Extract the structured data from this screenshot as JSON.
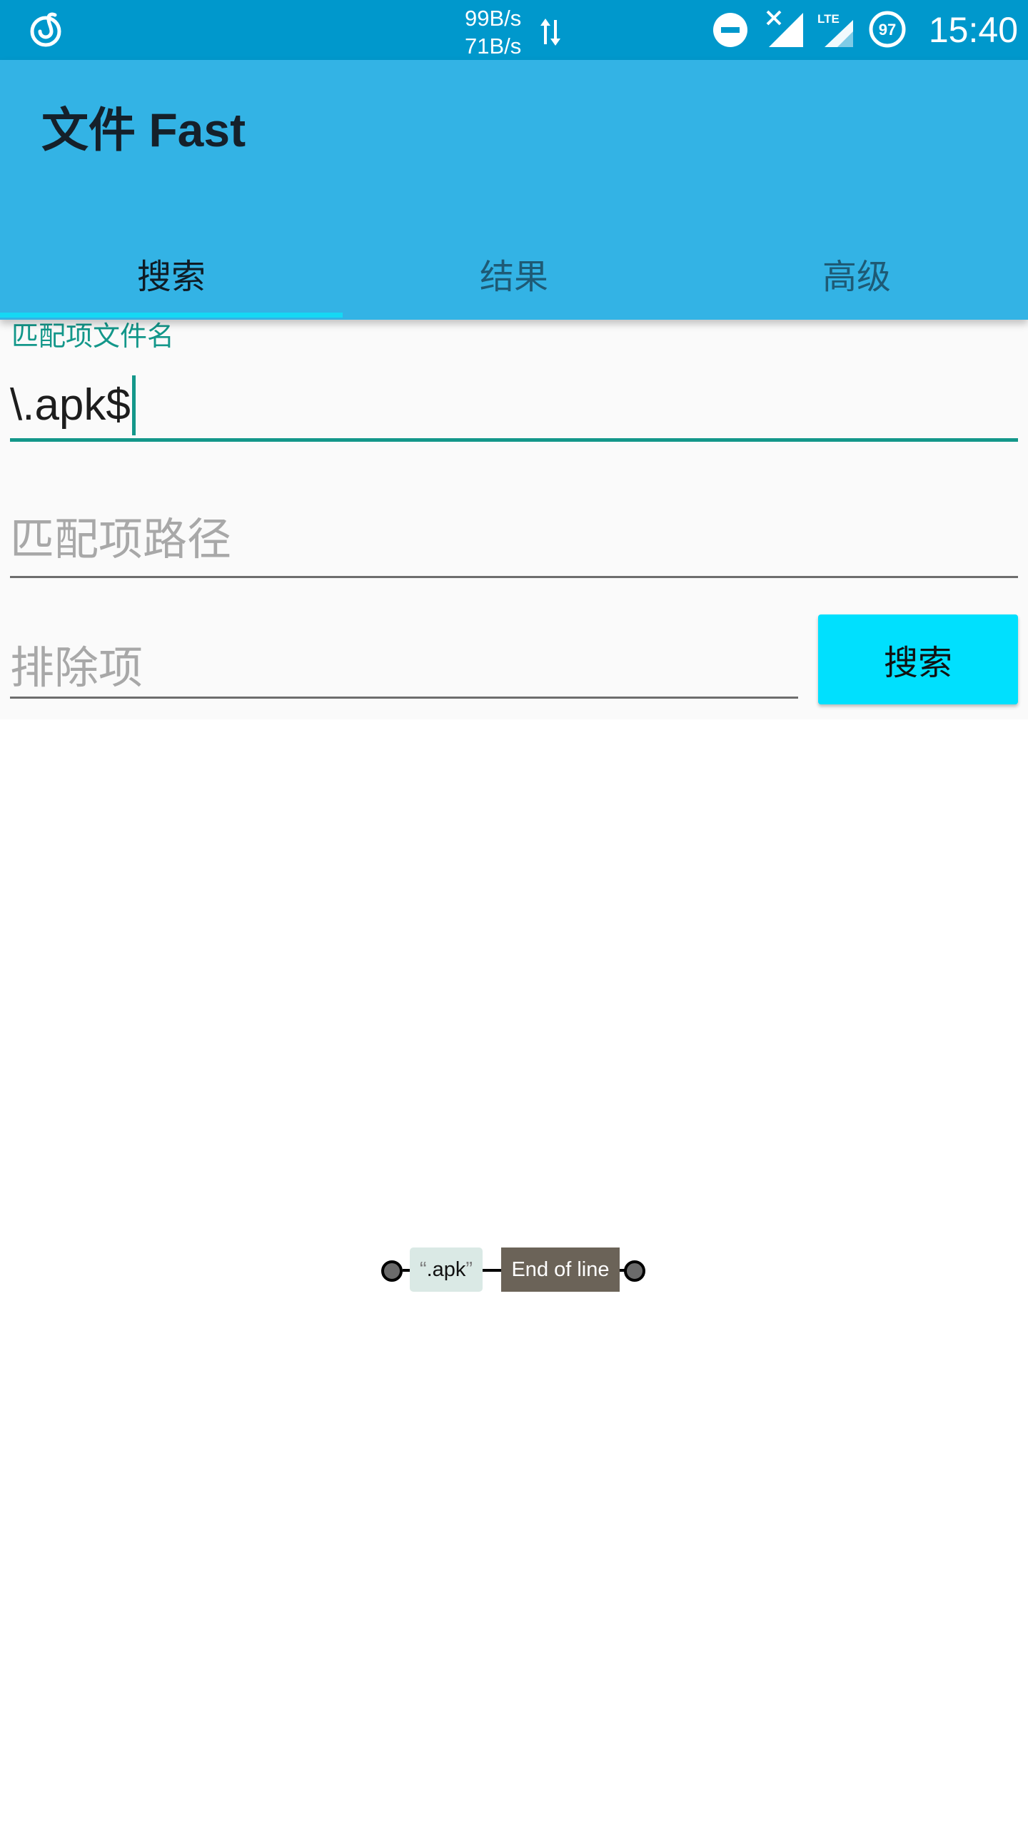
{
  "status_bar": {
    "speed_up": "99B/s",
    "speed_down": "71B/s",
    "battery_level": "97",
    "lte_label": "LTE",
    "time": "15:40",
    "icons": [
      "netease-music-icon",
      "data-transfer-arrows-icon",
      "do-not-disturb-icon",
      "signal-no-sim-icon",
      "signal-lte-icon",
      "battery-ring-icon"
    ]
  },
  "app_bar": {
    "title": "文件 Fast",
    "tabs": [
      {
        "label": "搜索",
        "active": true
      },
      {
        "label": "结果",
        "active": false
      },
      {
        "label": "高级",
        "active": false
      }
    ]
  },
  "form": {
    "filename_label": "匹配项文件名",
    "filename_value": "\\.apk$",
    "path_placeholder": "匹配项路径",
    "exclude_placeholder": "排除项",
    "search_button": "搜索"
  },
  "railroad": {
    "literal_open_quote": "“",
    "literal_text": ".apk",
    "literal_close_quote": "”",
    "anchor_label": "End of line"
  },
  "colors": {
    "status_bar_bg": "#0098cc",
    "app_bar_bg": "#33b3e5",
    "accent": "#13978a",
    "tab_indicator": "#15d8f4",
    "button_bg": "#00e0fe"
  }
}
